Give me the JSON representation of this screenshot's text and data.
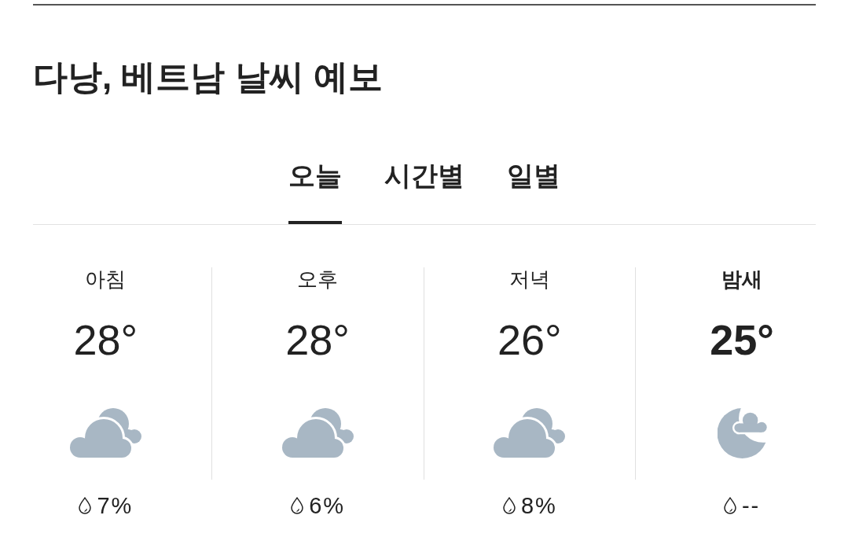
{
  "title": "다낭, 베트남 날씨 예보",
  "tabs": [
    {
      "label": "오늘",
      "selected": true
    },
    {
      "label": "시간별",
      "selected": false
    },
    {
      "label": "일별",
      "selected": false
    }
  ],
  "periods": [
    {
      "name": "아침",
      "temperature": "28°",
      "kind": "cloudy",
      "precipitation": "7%",
      "current": false
    },
    {
      "name": "오후",
      "temperature": "28°",
      "kind": "cloudy",
      "precipitation": "6%",
      "current": false
    },
    {
      "name": "저녁",
      "temperature": "26°",
      "kind": "cloudy",
      "precipitation": "8%",
      "current": false
    },
    {
      "name": "밤새",
      "temperature": "25°",
      "kind": "night-cloudy",
      "precipitation": "--",
      "current": true
    }
  ]
}
